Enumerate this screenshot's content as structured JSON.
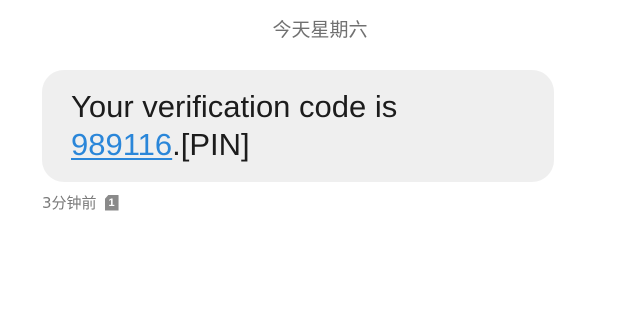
{
  "header": {
    "date_label": "今天星期六"
  },
  "message": {
    "line1": "Your verification code is",
    "code": "989116",
    "suffix": ".[PIN]"
  },
  "meta": {
    "timestamp": "3分钟前",
    "sim_slot": "1",
    "sim_icon": "sim-card-icon"
  },
  "colors": {
    "bubble_bg": "#efefef",
    "link": "#2a86d9",
    "meta_text": "#7a7a7a"
  }
}
